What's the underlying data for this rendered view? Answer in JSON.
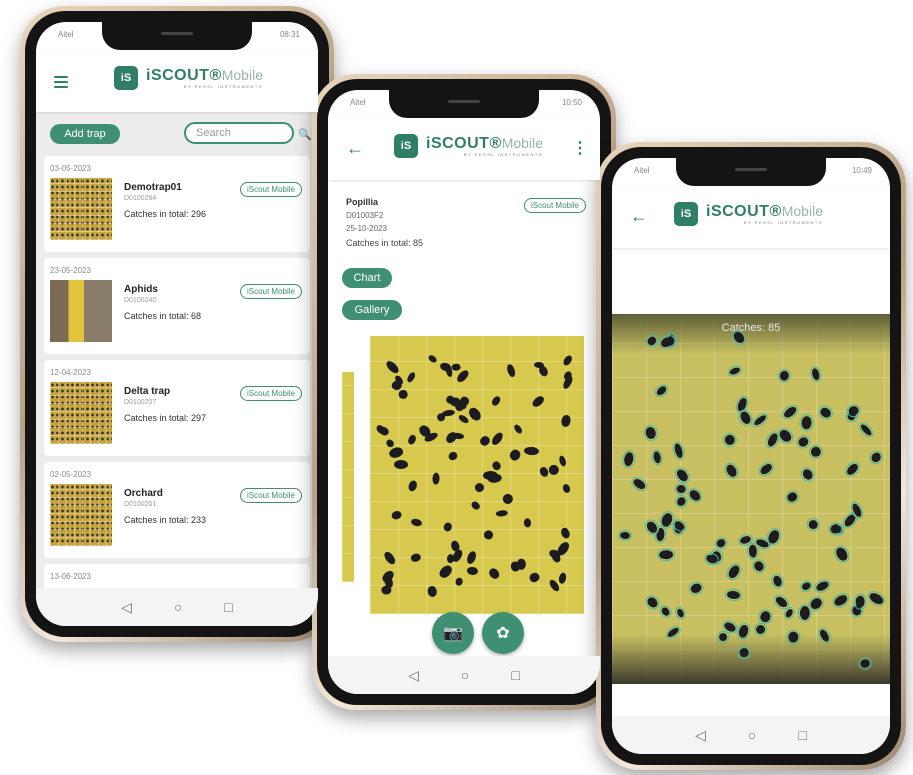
{
  "app": {
    "logo_mark": "iS",
    "logo_name": "iSCOUT®",
    "logo_suffix": "Mobile",
    "logo_sub": "BY PESSL INSTRUMENTS"
  },
  "colors": {
    "accent": "#3f8f73",
    "badge": "#3f8f73"
  },
  "phone1": {
    "status_left": "Aitel",
    "status_right": "08:31",
    "add_trap_label": "Add trap",
    "search_placeholder": "Search",
    "cards": [
      {
        "date": "03-05-2023",
        "name": "Demotrap01",
        "id": "D0100264",
        "catches": "Catches in total: 296",
        "badge": "iScout Mobile"
      },
      {
        "date": "23-05-2023",
        "name": "Aphids",
        "id": "D0100240",
        "catches": "Catches in total: 68",
        "badge": "iScout Mobile"
      },
      {
        "date": "12-04-2023",
        "name": "Delta trap",
        "id": "D0100207",
        "catches": "Catches in total: 297",
        "badge": "iScout Mobile"
      },
      {
        "date": "02-05-2023",
        "name": "Orchard",
        "id": "D0100201",
        "catches": "Catches in total: 233",
        "badge": "iScout Mobile"
      }
    ],
    "next_date": "13-06-2023"
  },
  "phone2": {
    "status_left": "Aitel",
    "status_right": "10:50",
    "title": "Popillia",
    "id": "D01003F2",
    "date": "25-10-2023",
    "catches": "Catches in total: 85",
    "badge": "iScout Mobile",
    "chart_label": "Chart",
    "gallery_label": "Gallery"
  },
  "phone3": {
    "status_left": "Aitel",
    "status_right": "10:49",
    "detect_label": "Catches: 85"
  },
  "nav": {
    "back": "◁",
    "home": "○",
    "recents": "□"
  }
}
